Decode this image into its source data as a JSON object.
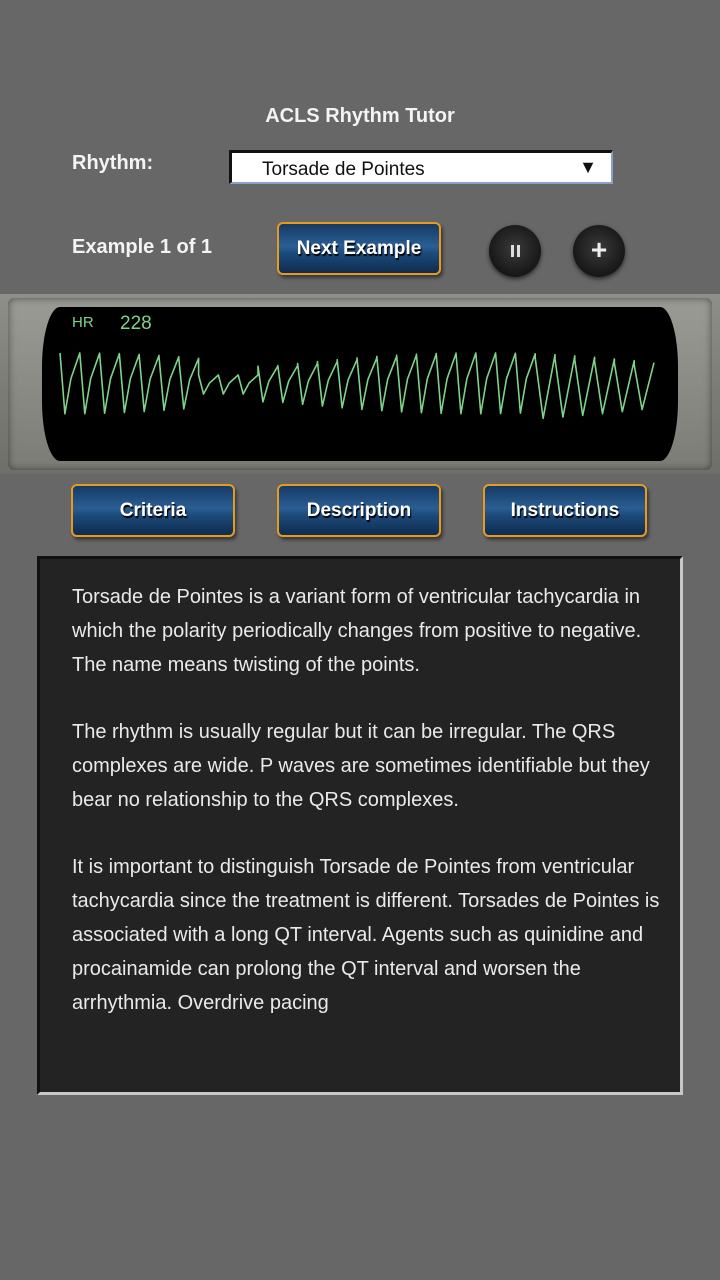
{
  "app": {
    "title": "ACLS Rhythm Tutor"
  },
  "rhythm": {
    "label": "Rhythm:",
    "selected": "Torsade de Pointes",
    "dropdown_icon": "triangle-down-icon",
    "dropdown_glyph": "▼"
  },
  "example": {
    "label": "Example 1 of 1",
    "next_label": "Next Example",
    "pause_icon": "pause-icon",
    "add_icon": "plus-icon",
    "add_glyph": "+"
  },
  "monitor": {
    "hr_label": "HR",
    "hr_value": "228",
    "trace_color": "#7ed38a"
  },
  "tabs": [
    {
      "label": "Criteria"
    },
    {
      "label": "Description"
    },
    {
      "label": "Instructions"
    }
  ],
  "description": {
    "paragraphs": [
      "Torsade de Pointes is a variant form of ventricular tachycardia in which the polarity periodically changes from positive to negative. The name means twisting of the points.",
      "The rhythm is usually regular but it can be irregular. The QRS complexes are wide. P waves are sometimes identifiable but they bear no relationship to the QRS complexes.",
      "It is important to distinguish Torsade de Pointes from ventricular tachycardia since the treatment is different. Torsades de Pointes is associated with a long QT interval. Agents such as quinidine and procainamide can prolong the QT interval and worsen the arrhythmia. Overdrive pacing"
    ]
  },
  "colors": {
    "background": "#676767",
    "button_border": "#e89a1e",
    "button_fill": "#1d4a7a",
    "panel_bg": "#232323"
  }
}
